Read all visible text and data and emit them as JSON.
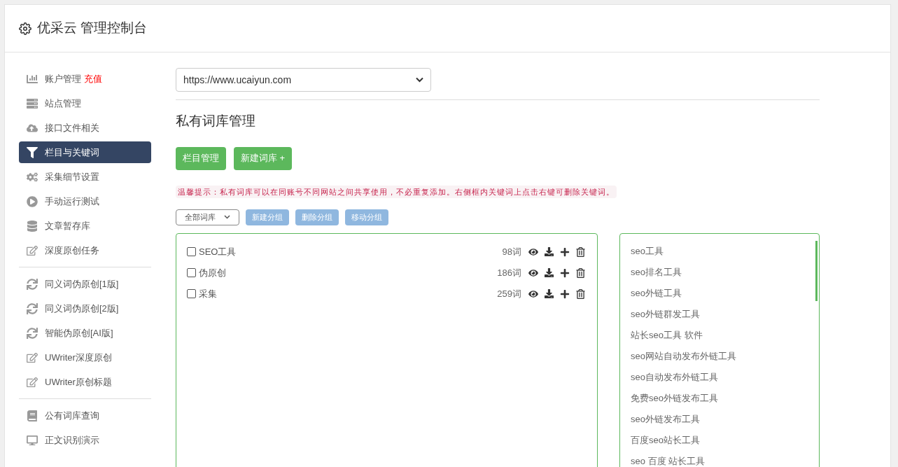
{
  "header": {
    "title": "优采云 管理控制台"
  },
  "sidebar": {
    "groups": [
      {
        "items": [
          {
            "label": "账户管理",
            "badge": "充值",
            "selected": false
          },
          {
            "label": "站点管理",
            "selected": false
          },
          {
            "label": "接口文件相关",
            "selected": false
          },
          {
            "label": "栏目与关键词",
            "selected": true
          },
          {
            "label": "采集细节设置",
            "selected": false
          },
          {
            "label": "手动运行测试",
            "selected": false
          },
          {
            "label": "文章暂存库",
            "selected": false
          },
          {
            "label": "深度原创任务",
            "selected": false
          }
        ]
      },
      {
        "items": [
          {
            "label": "同义词伪原创[1版]",
            "selected": false
          },
          {
            "label": "同义词伪原创[2版]",
            "selected": false
          },
          {
            "label": "智能伪原创[AI版]",
            "selected": false
          },
          {
            "label": "UWriter深度原创",
            "selected": false
          },
          {
            "label": "UWriter原创标题",
            "selected": false
          }
        ]
      },
      {
        "items": [
          {
            "label": "公有词库查询",
            "selected": false
          },
          {
            "label": "正文识别演示",
            "selected": false
          }
        ]
      }
    ]
  },
  "site_select": {
    "value": "https://www.ucaiyun.com"
  },
  "page_title": "私有词库管理",
  "buttons": [
    "栏目管理",
    "新建词库 +"
  ],
  "tip": "温馨提示：私有词库可以在同账号不同网站之间共享使用，不必重复添加。右侧框内关键词上点击右键可删除关键词。",
  "group_toolbar": {
    "filter": "全部词库",
    "buttons": [
      "新建分组",
      "删除分组",
      "移动分组"
    ]
  },
  "libraries": [
    {
      "name": "SEO工具",
      "count": "98词",
      "checked": false
    },
    {
      "name": "伪原创",
      "count": "186词",
      "checked": false
    },
    {
      "name": "采集",
      "count": "259词",
      "checked": false
    }
  ],
  "keywords": [
    "seo工具",
    "seo排名工具",
    "seo外链工具",
    "seo外链群发工具",
    "站长seo工具 软件",
    "seo网站自动发布外链工具",
    "seo自动发布外链工具",
    "免费seo外链发布工具",
    "seo外链发布工具",
    "百度seo站长工具",
    "seo 百度 站长工具"
  ]
}
